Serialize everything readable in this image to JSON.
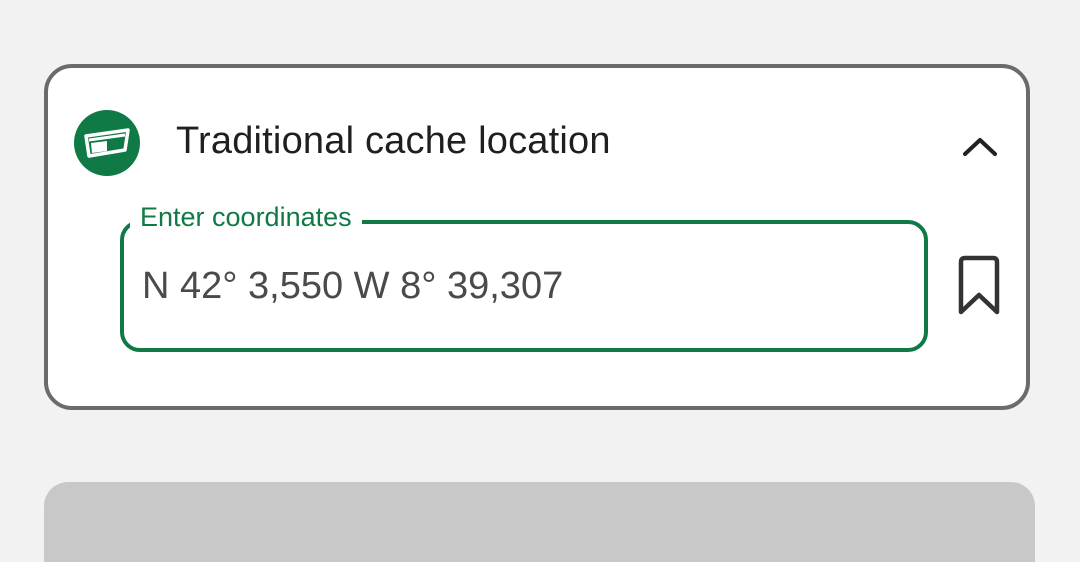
{
  "card": {
    "title": "Traditional cache location",
    "icon": "traditional-cache-icon",
    "collapse_icon": "chevron-up-icon",
    "coordinates_field": {
      "label": "Enter coordinates",
      "value": "N 42° 3,550 W 8° 39,307"
    },
    "bookmark_icon": "bookmark-icon"
  },
  "colors": {
    "accent": "#0f7a45",
    "card_border": "#6b6b6b",
    "background": "#f2f2f2",
    "next_card": "#c8c8c8"
  }
}
